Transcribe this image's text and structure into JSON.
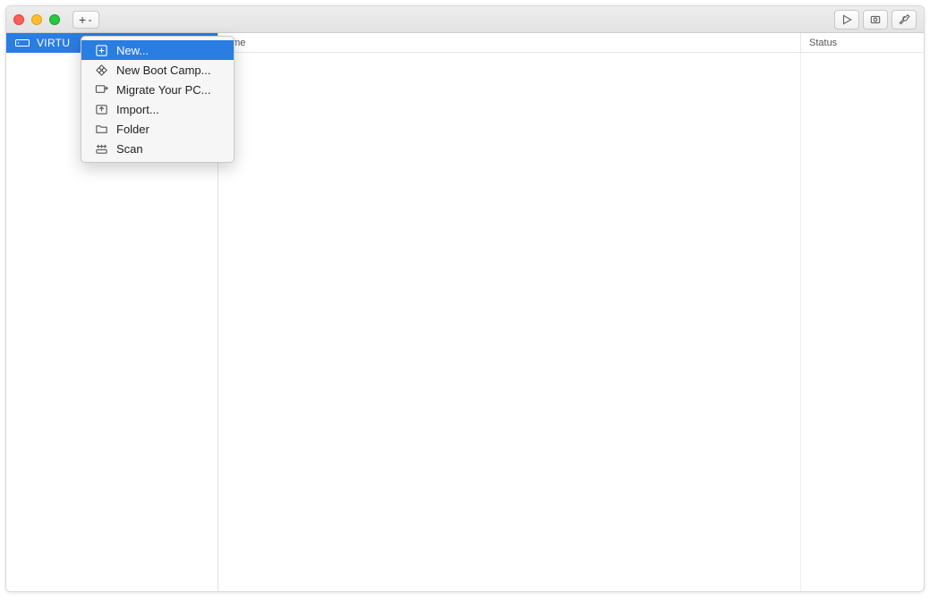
{
  "sidebar": {
    "item_label": "VIRTU"
  },
  "table": {
    "col_name": "ame",
    "col_status": "Status"
  },
  "dropdown": {
    "items": [
      {
        "label": "New..."
      },
      {
        "label": "New Boot Camp..."
      },
      {
        "label": "Migrate Your PC..."
      },
      {
        "label": "Import..."
      },
      {
        "label": "Folder"
      },
      {
        "label": "Scan"
      }
    ]
  }
}
